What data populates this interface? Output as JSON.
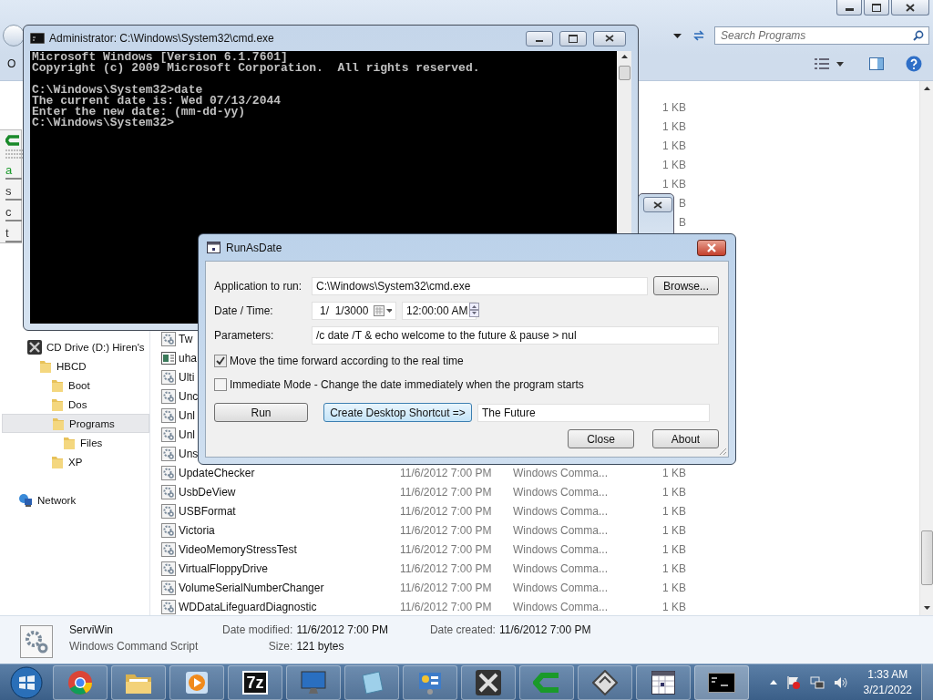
{
  "explorer": {
    "search": {
      "placeholder": "Search Programs"
    },
    "toolbar_label": "O",
    "side_buttons": [
      "a",
      "s",
      "c",
      "t"
    ],
    "nav": [
      {
        "label": "CD Drive (D:) Hiren's",
        "kind": "drive",
        "selected": false,
        "children": [
          {
            "label": "HBCD",
            "kind": "folder",
            "selected": false,
            "children": [
              {
                "label": "Boot",
                "kind": "folder",
                "selected": false
              },
              {
                "label": "Dos",
                "kind": "folder",
                "selected": false
              },
              {
                "label": "Programs",
                "kind": "folder",
                "selected": true,
                "children": [
                  {
                    "label": "Files",
                    "kind": "folder",
                    "selected": false
                  }
                ]
              },
              {
                "label": "XP",
                "kind": "folder",
                "selected": false
              }
            ]
          }
        ]
      },
      {
        "label": "Network",
        "kind": "network",
        "selected": false
      }
    ],
    "top_sizes": [
      "1 KB",
      "1 KB",
      "1 KB",
      "1 KB",
      "1 KB",
      "B",
      "B"
    ],
    "files": [
      {
        "name": "Tw",
        "kind": "script"
      },
      {
        "name": "uha",
        "kind": "app"
      },
      {
        "name": "Ulti",
        "kind": "script"
      },
      {
        "name": "Unc",
        "kind": "script"
      },
      {
        "name": "Unl",
        "kind": "script"
      },
      {
        "name": "Unl",
        "kind": "script"
      },
      {
        "name": "Uns",
        "kind": "script"
      },
      {
        "name": "UpdateChecker",
        "kind": "script",
        "date": "11/6/2012 7:00 PM",
        "type": "Windows Comma...",
        "size": "1 KB"
      },
      {
        "name": "UsbDeView",
        "kind": "script",
        "date": "11/6/2012 7:00 PM",
        "type": "Windows Comma...",
        "size": "1 KB"
      },
      {
        "name": "USBFormat",
        "kind": "script",
        "date": "11/6/2012 7:00 PM",
        "type": "Windows Comma...",
        "size": "1 KB"
      },
      {
        "name": "Victoria",
        "kind": "script",
        "date": "11/6/2012 7:00 PM",
        "type": "Windows Comma...",
        "size": "1 KB"
      },
      {
        "name": "VideoMemoryStressTest",
        "kind": "script",
        "date": "11/6/2012 7:00 PM",
        "type": "Windows Comma...",
        "size": "1 KB"
      },
      {
        "name": "VirtualFloppyDrive",
        "kind": "script",
        "date": "11/6/2012 7:00 PM",
        "type": "Windows Comma...",
        "size": "1 KB"
      },
      {
        "name": "VolumeSerialNumberChanger",
        "kind": "script",
        "date": "11/6/2012 7:00 PM",
        "type": "Windows Comma...",
        "size": "1 KB"
      },
      {
        "name": "WDDataLifeguardDiagnostic",
        "kind": "script",
        "date": "11/6/2012 7:00 PM",
        "type": "Windows Comma...",
        "size": "1 KB"
      }
    ],
    "details": {
      "name": "ServiWin",
      "type": "Windows Command Script",
      "fields": [
        {
          "label": "Date modified:",
          "value": "11/6/2012 7:00 PM"
        },
        {
          "label": "Size:",
          "value": "121 bytes"
        },
        {
          "label": "Date created:",
          "value": "11/6/2012 7:00 PM"
        }
      ]
    }
  },
  "console": {
    "title": "Administrator: C:\\Windows\\System32\\cmd.exe",
    "blocks": [
      [
        "Microsoft Windows [Version 6.1.7601]",
        "Copyright (c) 2009 Microsoft Corporation.  All rights reserved."
      ],
      [
        "C:\\Windows\\System32>date",
        "The current date is: Wed 07/13/2044",
        "Enter the new date: (mm-dd-yy)",
        "C:\\Windows\\System32>"
      ]
    ]
  },
  "dialog": {
    "title": "RunAsDate",
    "app_label": "Application to run:",
    "app_value": "C:\\Windows\\System32\\cmd.exe",
    "browse": "Browse...",
    "date_label": "Date / Time:",
    "date": "1/  1/3000",
    "time": "12:00:00 AM",
    "params_label": "Parameters:",
    "params": "/c date /T & echo welcome to the future & pause > nul",
    "options": [
      {
        "label": "Move the time forward according to the real time",
        "checked": true
      },
      {
        "label": "Immediate Mode - Change the date immediately when the program starts",
        "checked": false
      }
    ],
    "run": "Run",
    "shortcut": "Create Desktop Shortcut =>",
    "shortcut_name": "The Future",
    "close": "Close",
    "about": "About"
  },
  "taskbar": {
    "apps": [
      {
        "kind": "chrome"
      },
      {
        "kind": "folders"
      },
      {
        "kind": "media"
      },
      {
        "kind": "archive",
        "label": "7z"
      },
      {
        "kind": "monitor"
      },
      {
        "kind": "notepad"
      },
      {
        "kind": "panel"
      },
      {
        "kind": "tools"
      },
      {
        "kind": "green-c"
      },
      {
        "kind": "floppy"
      },
      {
        "kind": "calendar"
      },
      {
        "kind": "console"
      }
    ],
    "clock": {
      "time": "1:33 AM",
      "date": "3/21/2022"
    }
  }
}
